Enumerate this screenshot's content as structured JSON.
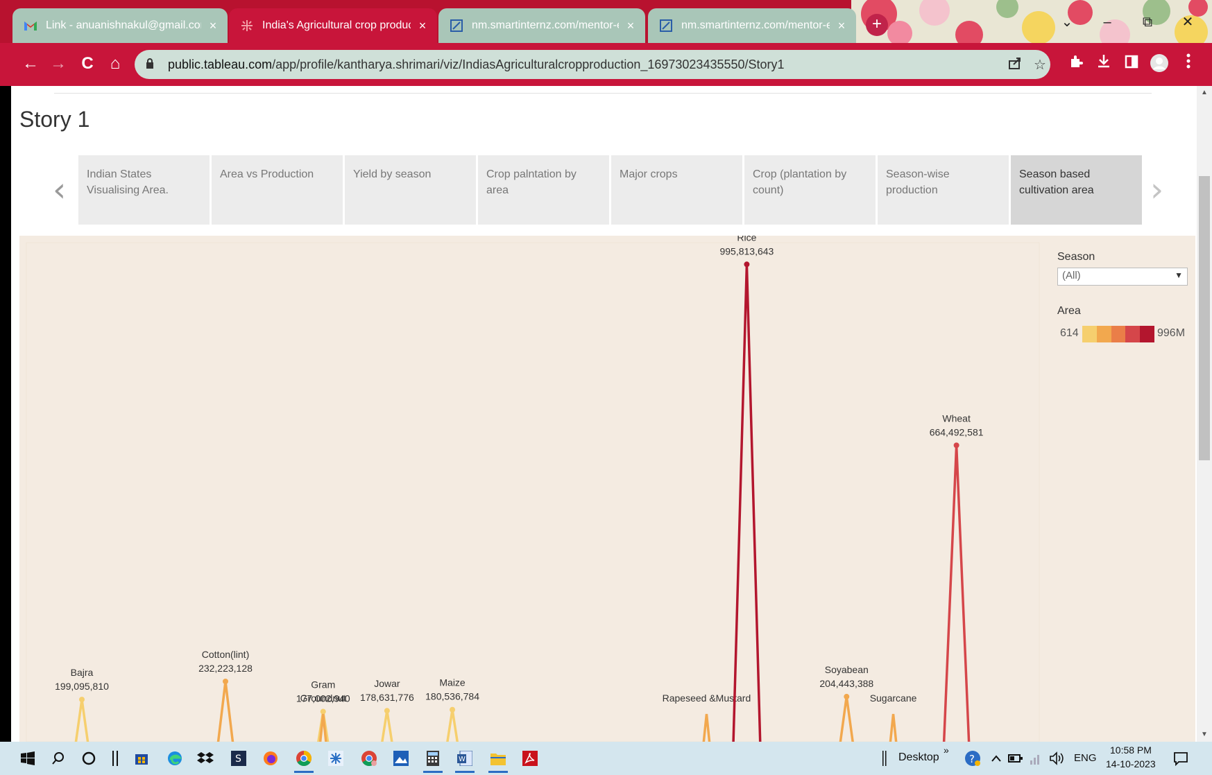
{
  "browser": {
    "tabs": [
      {
        "title": "Link - anuanishnakul@gmail.com",
        "close": "×",
        "icon": "gmail-icon",
        "active": false
      },
      {
        "title": "India's Agricultural crop production",
        "close": "×",
        "icon": "tableau-icon",
        "active": true
      },
      {
        "title": "nm.smartinternz.com/mentor-ex",
        "close": "×",
        "icon": "smartinternz-icon",
        "active": false
      },
      {
        "title": "nm.smartinternz.com/mentor-ex",
        "close": "×",
        "icon": "smartinternz-icon",
        "active": false
      }
    ],
    "new_tab": "+",
    "window": {
      "dropdown": "⌄",
      "minimize": "–",
      "restore": "⧉",
      "close": "✕"
    },
    "nav": {
      "back": "←",
      "forward": "→",
      "reload": "C",
      "home": "⌂"
    },
    "url_host": "public.tableau.com",
    "url_path": "/app/profile/kantharya.shrimari/viz/IndiasAgriculturalcropproduction_16973023435550/Story1"
  },
  "story": {
    "title": "Story 1",
    "prev": "‹",
    "next": "›",
    "points": [
      {
        "label": "Indian States Visualising Area.",
        "selected": false
      },
      {
        "label": "Area vs Production",
        "selected": false
      },
      {
        "label": "Yield by season",
        "selected": false
      },
      {
        "label": "Crop palntation by area",
        "selected": false
      },
      {
        "label": "Major crops",
        "selected": false
      },
      {
        "label": "Crop (plantation by count)",
        "selected": false
      },
      {
        "label": "Season-wise production",
        "selected": false
      },
      {
        "label": "Season based cultivation area",
        "selected": true
      }
    ]
  },
  "filters": {
    "season_title": "Season",
    "season_value": "(All)",
    "area_title": "Area",
    "area_min": "614",
    "area_max": "996M",
    "ramp_colors": [
      "#f6cf6e",
      "#f2a84e",
      "#ea7e48",
      "#d5464a",
      "#b3162e"
    ]
  },
  "chart_data": {
    "type": "line",
    "title": "",
    "xlabel": "",
    "ylabel": "",
    "ylim": [
      0,
      1000000000
    ],
    "series": [
      {
        "values": [
          199095810,
          232223128,
          177002940,
          178631776,
          180536784,
          995813643,
          204443388,
          664492581
        ]
      }
    ],
    "points": [
      {
        "crop": "Bajra",
        "value_label": "199,095,810",
        "value": 199095810
      },
      {
        "crop": "Cotton(lint)",
        "value_label": "232,223,128",
        "value": 232223128
      },
      {
        "crop": "Gram",
        "value_label": "177,002,940",
        "value": 177002940
      },
      {
        "crop": "Groundnut",
        "value_label": "",
        "value": null
      },
      {
        "crop": "Jowar",
        "value_label": "178,631,776",
        "value": 178631776
      },
      {
        "crop": "Maize",
        "value_label": "180,536,784",
        "value": 180536784
      },
      {
        "crop": "Rapeseed &Mustard",
        "value_label": "",
        "value": null
      },
      {
        "crop": "Rice",
        "value_label": "995,813,643",
        "value": 995813643
      },
      {
        "crop": "Soyabean",
        "value_label": "204,443,388",
        "value": 204443388
      },
      {
        "crop": "Sugarcane",
        "value_label": "",
        "value": null
      },
      {
        "crop": "Wheat",
        "value_label": "664,492,581",
        "value": 664492581
      }
    ]
  },
  "taskbar": {
    "desktop_label": "Desktop",
    "overflow": "»",
    "language": "ENG",
    "time": "10:58 PM",
    "date": "14-10-2023"
  }
}
